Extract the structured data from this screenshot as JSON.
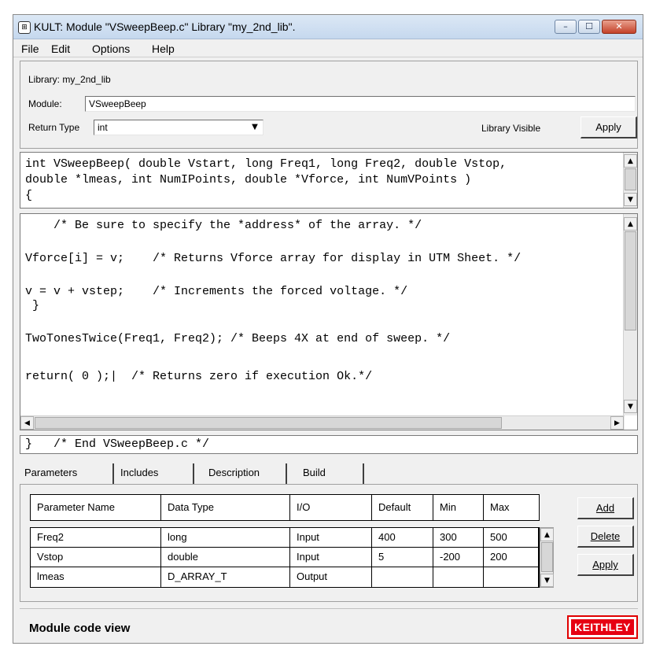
{
  "window": {
    "title": "KULT: Module \"VSweepBeep.c\" Library \"my_2nd_lib\".",
    "app_icon_glyph": "⊞",
    "controls": {
      "minimize": "–",
      "maximize": "☐",
      "close": "✕"
    }
  },
  "menu": [
    "File",
    "Edit",
    "Options",
    "Help"
  ],
  "info": {
    "library_label": "Library: my_2nd_lib",
    "module_label": "Module:",
    "module_value": "VSweepBeep",
    "return_type_label": "Return Type",
    "return_type_value": "int",
    "library_visible_label": "Library Visible",
    "apply_label": "Apply"
  },
  "signature": {
    "lines": [
      "int VSweepBeep( double Vstart, long Freq1, long Freq2, double Vstop,",
      "double *lmeas, int NumIPoints, double *Vforce, int NumVPoints )",
      "{"
    ]
  },
  "code": {
    "lines": [
      "    /* Be sure to specify the *address* of the array. */",
      "",
      "Vforce[i] = v;    /* Returns Vforce array for display in UTM Sheet. */",
      "",
      "v = v + vstep;    /* Increments the forced voltage. */",
      " }",
      "",
      "TwoTonesTwice(Freq1, Freq2); /* Beeps 4X at end of sweep. */",
      "",
      "return( 0 );|  /* Returns zero if execution Ok.*/"
    ]
  },
  "footer_line": "}   /* End VSweepBeep.c */",
  "tabs": [
    "Parameters",
    "Includes",
    "Description",
    "Build"
  ],
  "params": {
    "columns": [
      "Parameter Name",
      "Data Type",
      "I/O",
      "Default",
      "Min",
      "Max"
    ],
    "rows": [
      [
        "Freq2",
        "long",
        "Input",
        "400",
        "300",
        "500"
      ],
      [
        "Vstop",
        "double",
        "Input",
        "5",
        "-200",
        "200"
      ],
      [
        "lmeas",
        "D_ARRAY_T",
        "Output",
        "",
        "",
        ""
      ]
    ],
    "add_label": "Add",
    "delete_label": "Delete",
    "apply_label": "Apply"
  },
  "status": {
    "text": "Module code view",
    "logo": "KEITHLEY",
    "logo_color": "#e60012"
  }
}
